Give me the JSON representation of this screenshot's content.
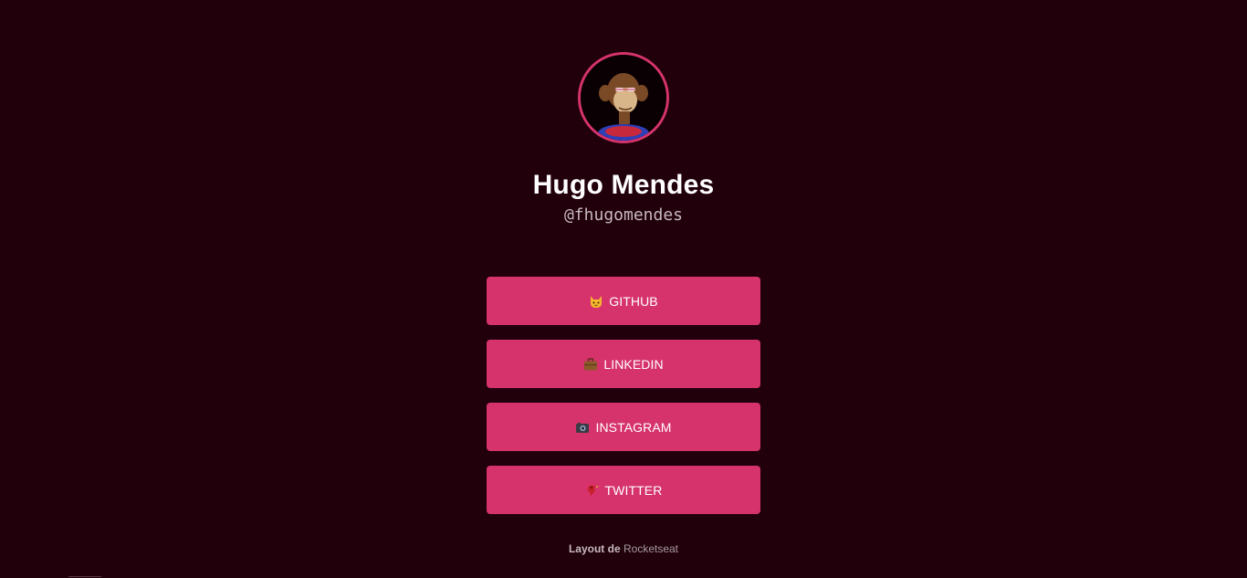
{
  "profile": {
    "name": "Hugo Mendes",
    "handle": "@fhugomendes",
    "avatar_icon": "bored-ape-avatar"
  },
  "links": [
    {
      "label": "GITHUB",
      "icon": "cat-face-icon"
    },
    {
      "label": "LINKEDIN",
      "icon": "briefcase-icon"
    },
    {
      "label": "INSTAGRAM",
      "icon": "camera-icon"
    },
    {
      "label": "TWITTER",
      "icon": "bird-icon"
    }
  ],
  "footer": {
    "prefix": "Layout de",
    "link": "Rocketseat"
  },
  "colors": {
    "background": "#21000b",
    "accent": "#d6336c",
    "text": "#ffffff",
    "muted": "#c7b9bd"
  }
}
